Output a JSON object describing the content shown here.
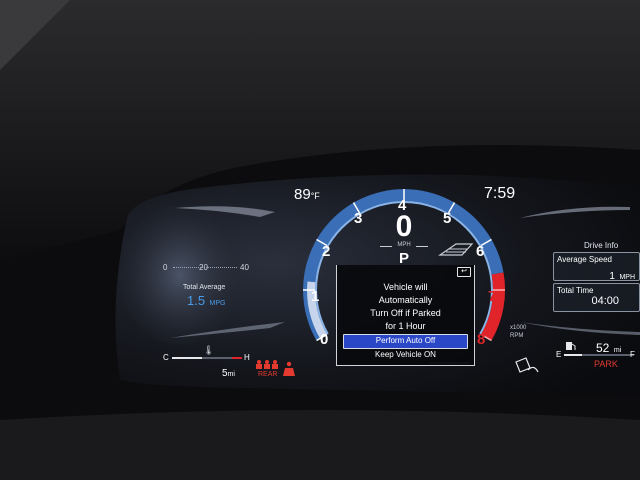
{
  "status": {
    "temperature": "89",
    "temp_unit": "°F",
    "clock": "7:59"
  },
  "speed": {
    "value": "0",
    "unit": "MPH",
    "gear": "P"
  },
  "tach": {
    "ticks": [
      "0",
      "1",
      "2",
      "3",
      "4",
      "5",
      "6",
      "7",
      "8"
    ],
    "unit_line1": "x1000",
    "unit_line2": "RPM"
  },
  "left_panel": {
    "scale": [
      "0",
      "20",
      "40"
    ],
    "label": "Total Average",
    "value": "1.5",
    "unit": "MPG"
  },
  "dialog": {
    "line1": "Vehicle will",
    "line2": "Automatically",
    "line3": "Turn Off if Parked",
    "line4": "for 1 Hour",
    "option_selected": "Perform Auto Off",
    "option_other": "Keep Vehicle ON"
  },
  "right_panel": {
    "title": "Drive Info",
    "avg_speed_label": "Average Speed",
    "avg_speed_value": "1",
    "avg_speed_unit": "MPH",
    "total_time_label": "Total Time",
    "total_time_value": "04:00"
  },
  "bottom_left": {
    "temp_cold": "C",
    "temp_hot": "H",
    "range": "5",
    "range_unit": "mi",
    "rear_label": "REAR"
  },
  "bottom_right": {
    "fuel_empty": "E",
    "fuel_full": "F",
    "range": "52",
    "range_unit": "mi",
    "park_label": "PARK"
  },
  "colors": {
    "accent_blue": "#4a8fd8",
    "redline": "#e0242a",
    "dialog_highlight": "#2a47c8",
    "warning_red": "#e43a30"
  }
}
